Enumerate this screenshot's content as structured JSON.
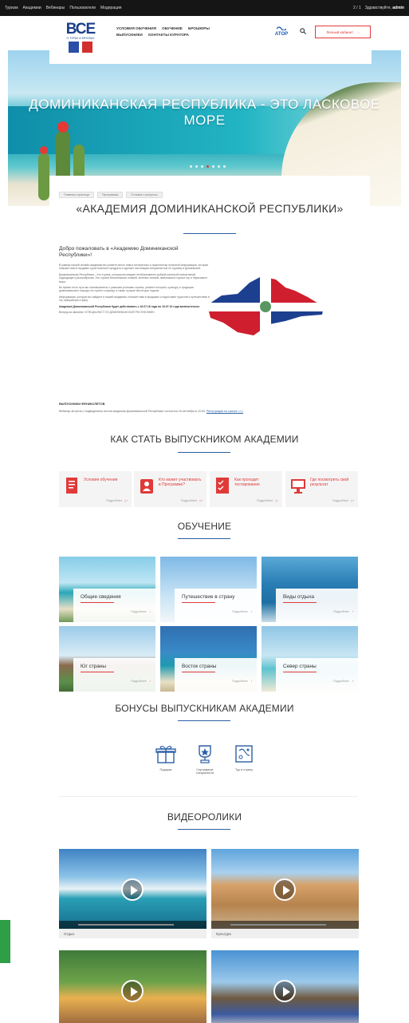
{
  "topbar": {
    "nav": [
      "Туризм",
      "Академии",
      "Вебинары",
      "Пользователи",
      "Модерация"
    ],
    "counter": "2 / 1",
    "greeting": "Здравствуйте,",
    "user": "admin"
  },
  "header": {
    "logo_text": "ВСЕ",
    "logo_subtitle": "О ТУРАХ И КРУИЗАХ",
    "nav": [
      "УСЛОВИЯ ОБУЧЕНИЯ",
      "ОБУЧЕНИЕ",
      "БРОШЮРЫ",
      "ВЫПУСКНИКИ",
      "КОНТАКТЫ КУРАТОРА"
    ],
    "partner": "АТОР",
    "cabinet": "Личный кабинет"
  },
  "hero": {
    "title": "ДОМИНИКАНСКАЯ РЕСПУБЛИКА - ЭТО ЛАСКОВОЕ МОРЕ",
    "dots": 7,
    "active_dot": 3
  },
  "breadcrumbs": [
    "Главная страница",
    "Программы",
    "Отзывы и вопросы"
  ],
  "academy": {
    "title": "«АКАДЕМИЯ ДОМИНИКАНСКОЙ РЕСПУБЛИКИ»",
    "welcome": "Добро пожаловать в «Академию Доминиканской Республики»!",
    "paragraphs": [
      "В рамках нашей онлайн-академии вы узнаете много новых интересных и практически полезной информации, которая поможет вам в продаже туристического продукта и сделает настоящим специалистом по туризму в Доминикане.",
      "Доминиканская Республика – это страна, которая восхищает необыкновенно доброй палитрой впечатлений, подходящего разнообразия. Это страна белоснежных пляжей, зеленых холмов, живописных горных гор и бирюзового моря.",
      "Во время этого пути вы познакомитесь с разными уголками страны, узнаете историю, культуру и традиции доминиканского народа, его кухню и музыку, а также лучшие места для отдыха.",
      "Информация, которую вы найдете в нашей академии, поможет вам в продажах и подготовке туристов к путешествию в эту прекрасную страну."
    ],
    "validity": "Академия Доминиканской Республики будет действовать с 16.07.18 года по 16.07.19 года включительно",
    "cert": "Вперед за званием «СПЕЦИАЛИСТ ПО ДОМИНИКАНСКОЙ РЕСПУБЛИКЕ»",
    "graduates_heading": "ВЫПУСКНИКИ ФЕНИКСЛЕТОВ",
    "graduates_text": "Вебинар-встреча с подведением итогов академии Доминиканской Республики состоится 18 сентября в 10:00.",
    "graduates_link": "Регистрация по ссылке >>>"
  },
  "steps_section": {
    "title": "КАК СТАТЬ ВЫПУСКНИКОМ АКАДЕМИИ",
    "more": "Подробнее",
    "items": [
      {
        "label": "Условия обучения",
        "icon": "document-icon"
      },
      {
        "label": "Кто может участвовать в Программе?",
        "icon": "user-badge-icon"
      },
      {
        "label": "Как проходит тестирование",
        "icon": "checklist-icon"
      },
      {
        "label": "Где посмотреть свой результат",
        "icon": "monitor-icon"
      }
    ]
  },
  "learning_section": {
    "title": "ОБУЧЕНИЕ",
    "more": "Подробнее",
    "tiles": [
      "Общие сведения",
      "Путешествие в страну",
      "Виды отдыха",
      "Юг страны",
      "Восток страны",
      "Север страны"
    ]
  },
  "bonus_section": {
    "title": "БОНУСЫ ВЫПУСКНИКАМ АКАДЕМИИ",
    "items": [
      {
        "label": "Подарки",
        "icon": "gift-icon"
      },
      {
        "label": "Сертификат специалиста",
        "icon": "award-icon"
      },
      {
        "label": "Тур в страну",
        "icon": "map-icon"
      }
    ]
  },
  "video_section": {
    "title": "ВИДЕОРОЛИКИ",
    "videos": [
      "Отдых",
      "Культура",
      "",
      ""
    ]
  },
  "colors": {
    "accent": "#e03a3a",
    "brand_blue": "#1a3e8a",
    "line_blue": "#2b5fa6"
  }
}
